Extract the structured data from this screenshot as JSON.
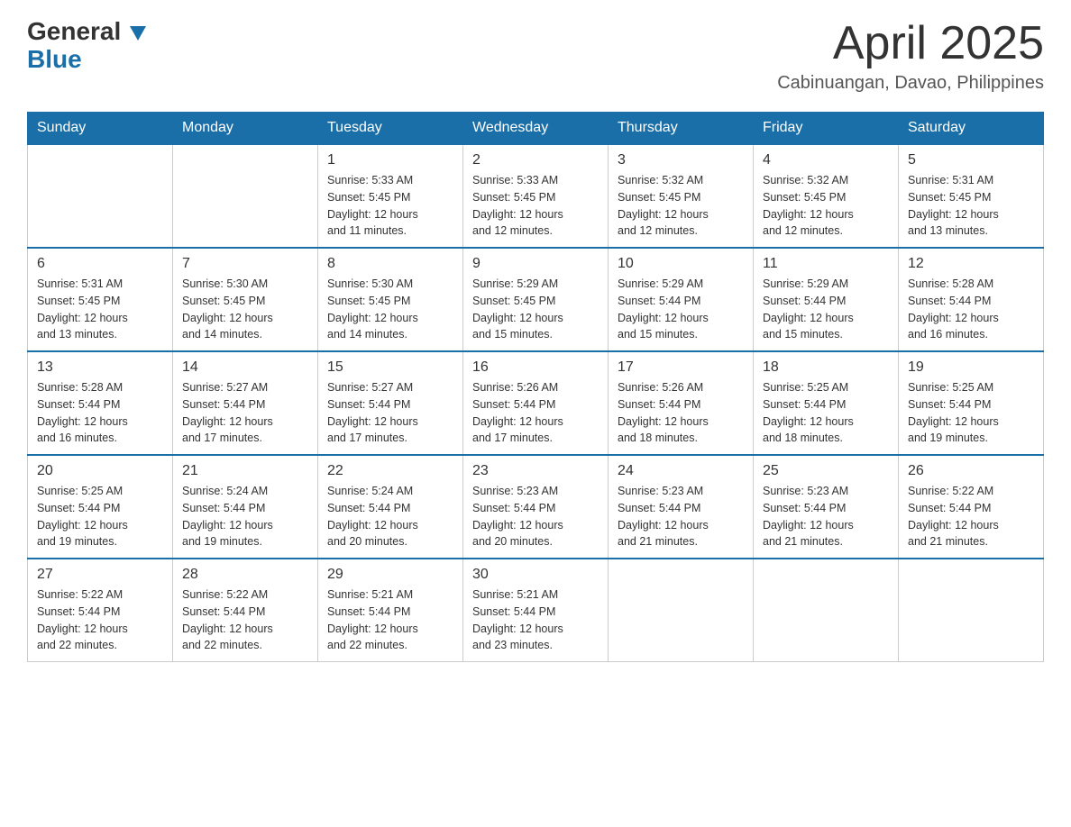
{
  "header": {
    "logo": {
      "general": "General",
      "blue": "Blue"
    },
    "title": "April 2025",
    "location": "Cabinuangan, Davao, Philippines"
  },
  "calendar": {
    "days": [
      "Sunday",
      "Monday",
      "Tuesday",
      "Wednesday",
      "Thursday",
      "Friday",
      "Saturday"
    ],
    "weeks": [
      [
        {
          "day": "",
          "info": ""
        },
        {
          "day": "",
          "info": ""
        },
        {
          "day": "1",
          "info": "Sunrise: 5:33 AM\nSunset: 5:45 PM\nDaylight: 12 hours\nand 11 minutes."
        },
        {
          "day": "2",
          "info": "Sunrise: 5:33 AM\nSunset: 5:45 PM\nDaylight: 12 hours\nand 12 minutes."
        },
        {
          "day": "3",
          "info": "Sunrise: 5:32 AM\nSunset: 5:45 PM\nDaylight: 12 hours\nand 12 minutes."
        },
        {
          "day": "4",
          "info": "Sunrise: 5:32 AM\nSunset: 5:45 PM\nDaylight: 12 hours\nand 12 minutes."
        },
        {
          "day": "5",
          "info": "Sunrise: 5:31 AM\nSunset: 5:45 PM\nDaylight: 12 hours\nand 13 minutes."
        }
      ],
      [
        {
          "day": "6",
          "info": "Sunrise: 5:31 AM\nSunset: 5:45 PM\nDaylight: 12 hours\nand 13 minutes."
        },
        {
          "day": "7",
          "info": "Sunrise: 5:30 AM\nSunset: 5:45 PM\nDaylight: 12 hours\nand 14 minutes."
        },
        {
          "day": "8",
          "info": "Sunrise: 5:30 AM\nSunset: 5:45 PM\nDaylight: 12 hours\nand 14 minutes."
        },
        {
          "day": "9",
          "info": "Sunrise: 5:29 AM\nSunset: 5:45 PM\nDaylight: 12 hours\nand 15 minutes."
        },
        {
          "day": "10",
          "info": "Sunrise: 5:29 AM\nSunset: 5:44 PM\nDaylight: 12 hours\nand 15 minutes."
        },
        {
          "day": "11",
          "info": "Sunrise: 5:29 AM\nSunset: 5:44 PM\nDaylight: 12 hours\nand 15 minutes."
        },
        {
          "day": "12",
          "info": "Sunrise: 5:28 AM\nSunset: 5:44 PM\nDaylight: 12 hours\nand 16 minutes."
        }
      ],
      [
        {
          "day": "13",
          "info": "Sunrise: 5:28 AM\nSunset: 5:44 PM\nDaylight: 12 hours\nand 16 minutes."
        },
        {
          "day": "14",
          "info": "Sunrise: 5:27 AM\nSunset: 5:44 PM\nDaylight: 12 hours\nand 17 minutes."
        },
        {
          "day": "15",
          "info": "Sunrise: 5:27 AM\nSunset: 5:44 PM\nDaylight: 12 hours\nand 17 minutes."
        },
        {
          "day": "16",
          "info": "Sunrise: 5:26 AM\nSunset: 5:44 PM\nDaylight: 12 hours\nand 17 minutes."
        },
        {
          "day": "17",
          "info": "Sunrise: 5:26 AM\nSunset: 5:44 PM\nDaylight: 12 hours\nand 18 minutes."
        },
        {
          "day": "18",
          "info": "Sunrise: 5:25 AM\nSunset: 5:44 PM\nDaylight: 12 hours\nand 18 minutes."
        },
        {
          "day": "19",
          "info": "Sunrise: 5:25 AM\nSunset: 5:44 PM\nDaylight: 12 hours\nand 19 minutes."
        }
      ],
      [
        {
          "day": "20",
          "info": "Sunrise: 5:25 AM\nSunset: 5:44 PM\nDaylight: 12 hours\nand 19 minutes."
        },
        {
          "day": "21",
          "info": "Sunrise: 5:24 AM\nSunset: 5:44 PM\nDaylight: 12 hours\nand 19 minutes."
        },
        {
          "day": "22",
          "info": "Sunrise: 5:24 AM\nSunset: 5:44 PM\nDaylight: 12 hours\nand 20 minutes."
        },
        {
          "day": "23",
          "info": "Sunrise: 5:23 AM\nSunset: 5:44 PM\nDaylight: 12 hours\nand 20 minutes."
        },
        {
          "day": "24",
          "info": "Sunrise: 5:23 AM\nSunset: 5:44 PM\nDaylight: 12 hours\nand 21 minutes."
        },
        {
          "day": "25",
          "info": "Sunrise: 5:23 AM\nSunset: 5:44 PM\nDaylight: 12 hours\nand 21 minutes."
        },
        {
          "day": "26",
          "info": "Sunrise: 5:22 AM\nSunset: 5:44 PM\nDaylight: 12 hours\nand 21 minutes."
        }
      ],
      [
        {
          "day": "27",
          "info": "Sunrise: 5:22 AM\nSunset: 5:44 PM\nDaylight: 12 hours\nand 22 minutes."
        },
        {
          "day": "28",
          "info": "Sunrise: 5:22 AM\nSunset: 5:44 PM\nDaylight: 12 hours\nand 22 minutes."
        },
        {
          "day": "29",
          "info": "Sunrise: 5:21 AM\nSunset: 5:44 PM\nDaylight: 12 hours\nand 22 minutes."
        },
        {
          "day": "30",
          "info": "Sunrise: 5:21 AM\nSunset: 5:44 PM\nDaylight: 12 hours\nand 23 minutes."
        },
        {
          "day": "",
          "info": ""
        },
        {
          "day": "",
          "info": ""
        },
        {
          "day": "",
          "info": ""
        }
      ]
    ]
  }
}
